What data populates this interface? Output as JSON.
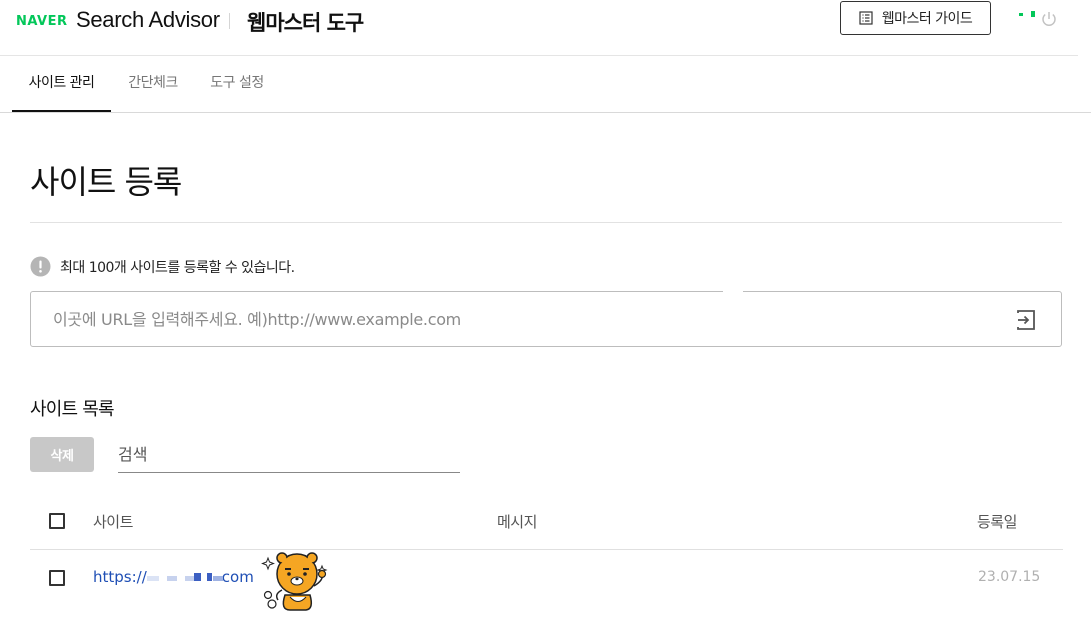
{
  "header": {
    "brand": "NAVER",
    "product": "Search Advisor",
    "subtitle": "웹마스터 도구",
    "guide_button": "웹마스터 가이드",
    "icons": {
      "guide": "document-list-icon",
      "logout": "power-icon"
    }
  },
  "tabs": [
    {
      "label": "사이트 관리",
      "active": true
    },
    {
      "label": "간단체크",
      "active": false
    },
    {
      "label": "도구 설정",
      "active": false
    }
  ],
  "page": {
    "title": "사이트 등록",
    "notice": "최대 100개 사이트를 등록할 수 있습니다.",
    "url_placeholder": "이곳에 URL을 입력해주세요. 예)http://www.example.com",
    "url_value": ""
  },
  "site_list": {
    "title": "사이트 목록",
    "delete_button": "삭제",
    "search_placeholder": "검색",
    "columns": [
      "사이트",
      "메시지",
      "등록일"
    ],
    "rows": [
      {
        "site_prefix": "https://",
        "site_suffix": "com",
        "message": "",
        "date": "23.07.15",
        "checked": false
      }
    ]
  },
  "colors": {
    "brand": "#03c75a",
    "link": "#1f4fb5",
    "disabled_button": "#c8c8c8",
    "mascot": "#f5a623"
  }
}
